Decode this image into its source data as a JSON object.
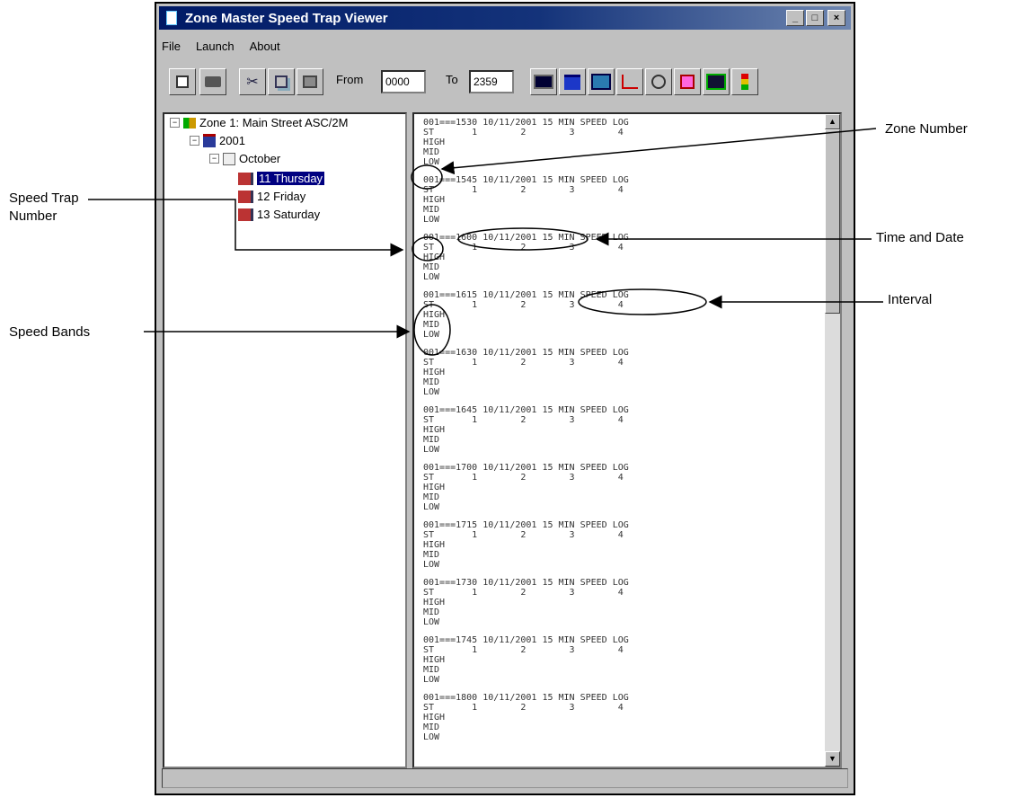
{
  "window": {
    "title": "Zone Master Speed Trap Viewer",
    "controls": [
      "_",
      "□",
      "×"
    ]
  },
  "menu": [
    "File",
    "Launch",
    "About"
  ],
  "toolbar": {
    "from_label": "From",
    "from_value": "0000",
    "to_label": "To",
    "to_value": "2359"
  },
  "tree": {
    "zone": "Zone   1: Main Street ASC/2M",
    "year": "2001",
    "month": "October",
    "days": [
      "11 Thursday",
      "12 Friday",
      "13 Saturday"
    ],
    "selected_day": "11 Thursday"
  },
  "log_lines": [
    "001===1530 10/11/2001 15 MIN SPEED LOG",
    "001===1545 10/11/2001 15 MIN SPEED LOG",
    "001===1600 10/11/2001 15 MIN SPEED LOG",
    "001===1615 10/11/2001 15 MIN SPEED LOG",
    "001===1630 10/11/2001 15 MIN SPEED LOG",
    "001===1645 10/11/2001 15 MIN SPEED LOG",
    "001===1700 10/11/2001 15 MIN SPEED LOG",
    "001===1715 10/11/2001 15 MIN SPEED LOG",
    "001===1730 10/11/2001 15 MIN SPEED LOG",
    "001===1745 10/11/2001 15 MIN SPEED LOG",
    "001===1800 10/11/2001 15 MIN SPEED LOG"
  ],
  "log_rows": {
    "header": "ST       1        2        3        4",
    "high": "HIGH",
    "mid": "MID",
    "low": "LOW"
  },
  "annotations": {
    "zone_number": "Zone Number",
    "speed_trap_number_1": "Speed Trap",
    "speed_trap_number_2": "Number",
    "time_and_date": "Time and Date",
    "interval": "Interval",
    "speed_bands": "Speed Bands"
  }
}
